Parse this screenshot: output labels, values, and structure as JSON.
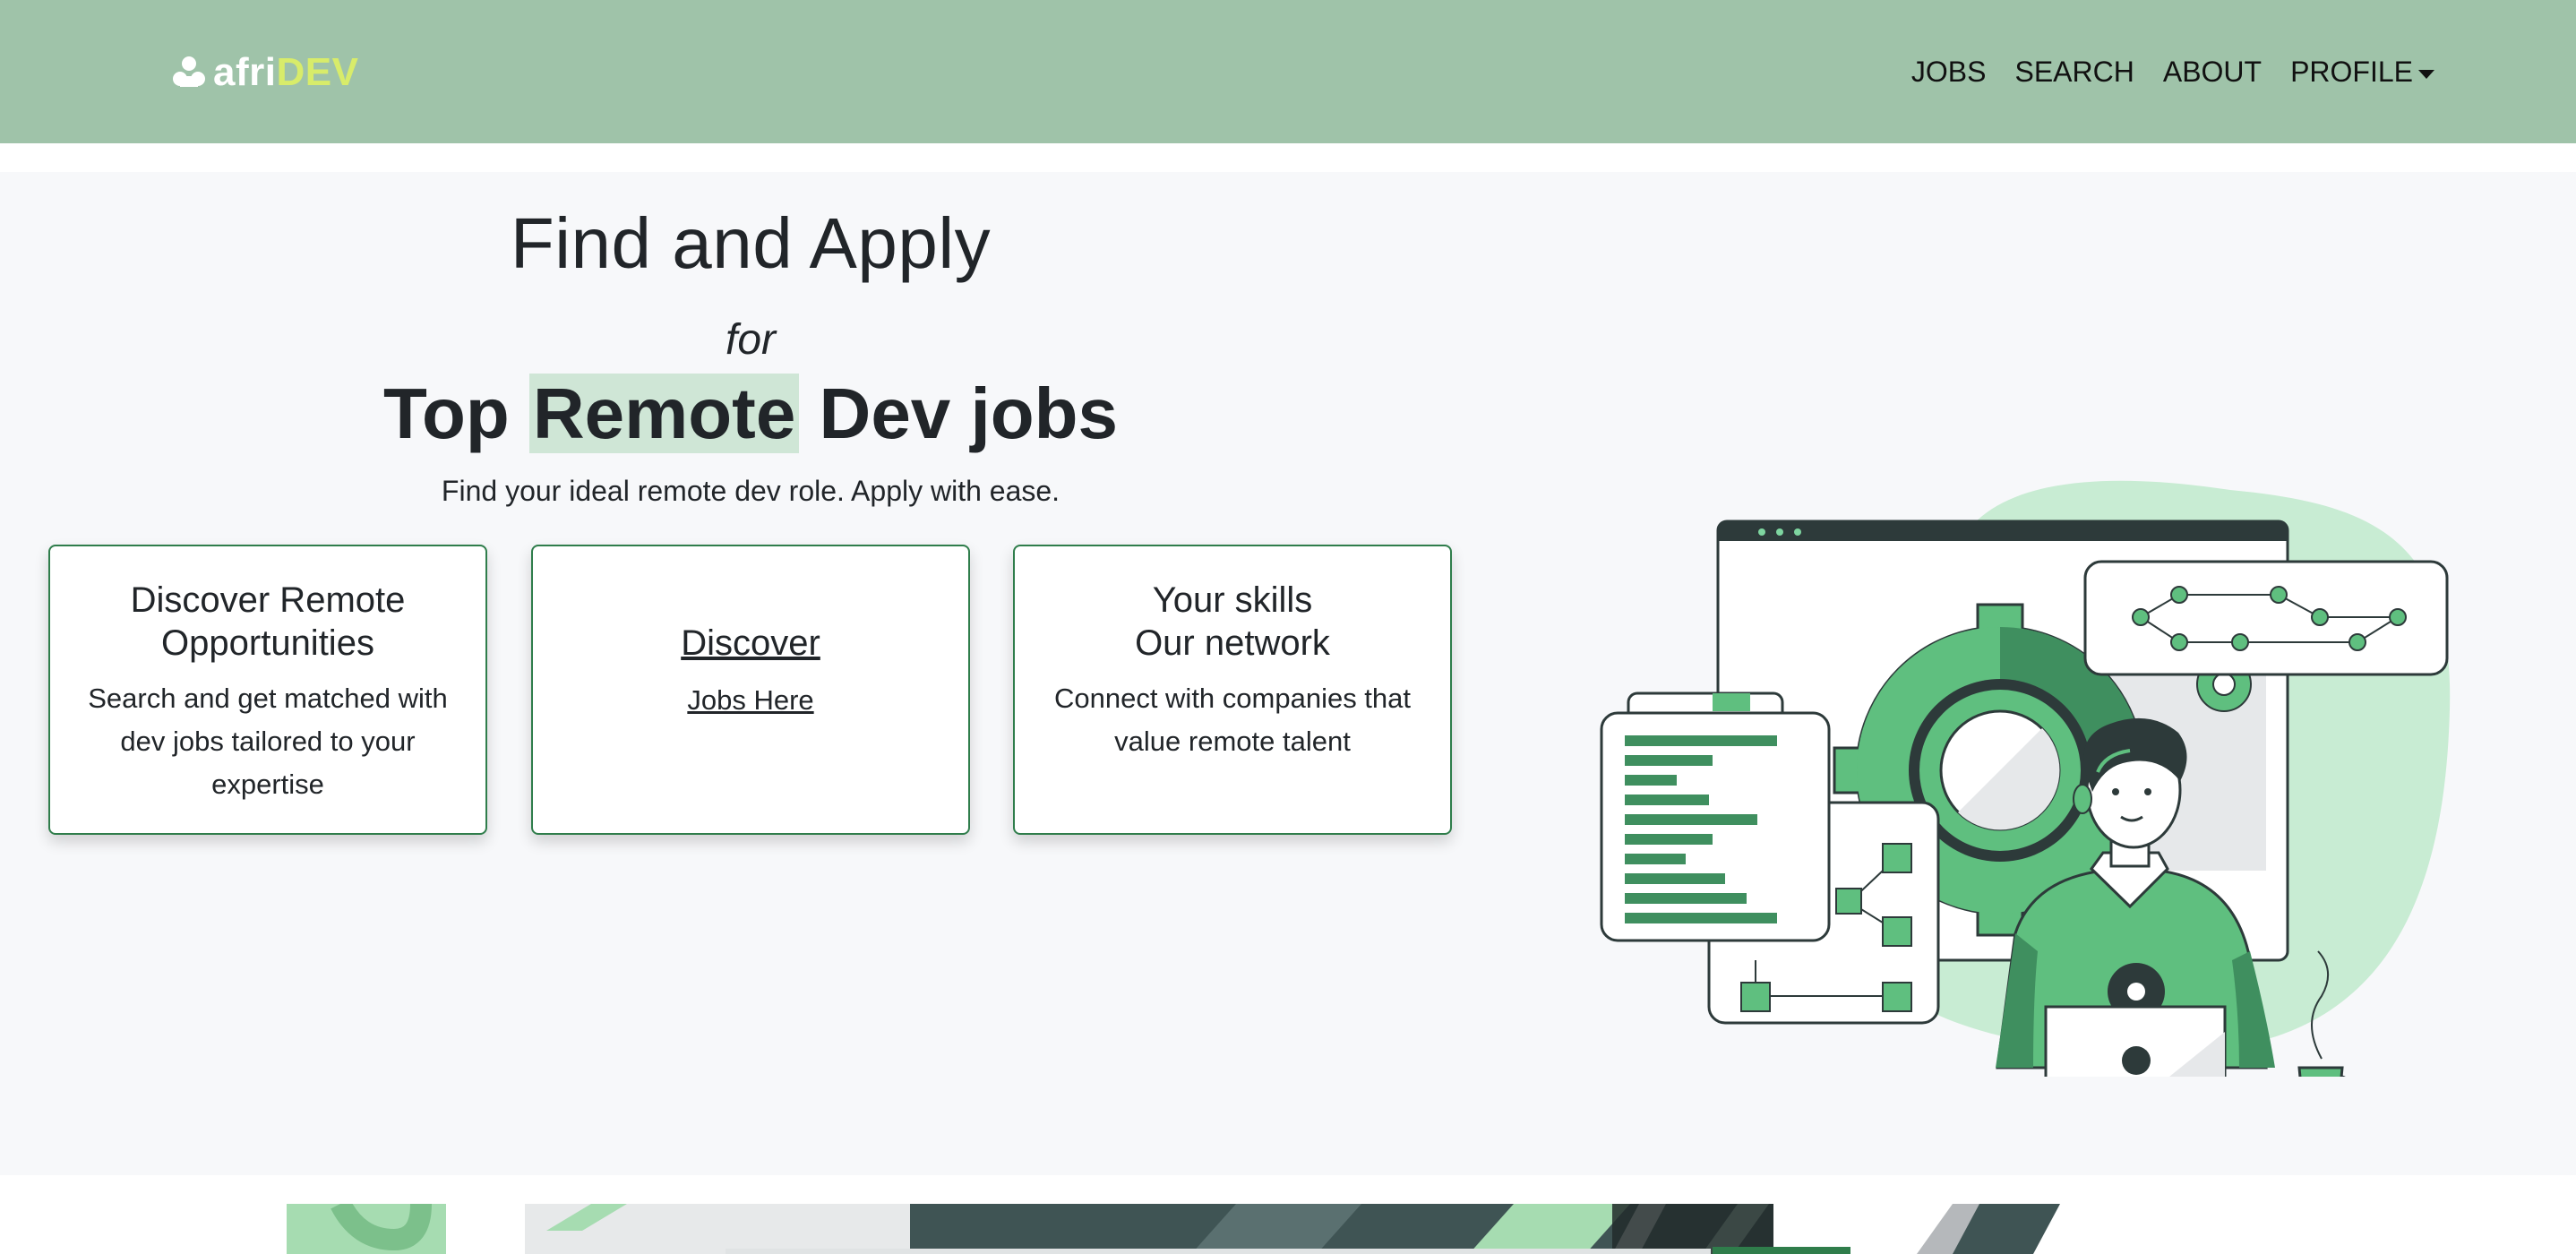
{
  "brand": {
    "name_prefix": "afri",
    "name_accent": "DEV",
    "icon": "people-logo-icon"
  },
  "nav": {
    "items": [
      {
        "label": "JOBS"
      },
      {
        "label": "SEARCH"
      },
      {
        "label": "ABOUT"
      },
      {
        "label": "PROFILE",
        "dropdown": true
      }
    ]
  },
  "hero": {
    "title": "Find and Apply",
    "for_word": "for",
    "subtitle_pre": "Top ",
    "subtitle_highlight": "Remote",
    "subtitle_post": " Dev jobs",
    "tagline": "Find your ideal remote dev role. Apply with ease."
  },
  "cards": [
    {
      "title_line1": "Discover Remote",
      "title_line2": "Opportunities",
      "text": "Search and get matched with dev jobs tailored to your expertise"
    },
    {
      "title": "Discover",
      "link": "Jobs Here"
    },
    {
      "title_line1": "Your skills",
      "title_line2": "Our network",
      "text": "Connect with companies that value remote talent"
    }
  ],
  "colors": {
    "navbar_bg": "#9fc3a9",
    "brand_accent": "#d8ec6a",
    "card_border": "#2f7d4b",
    "highlight": "#cfe6d6",
    "illustration_green": "#5fbf7f",
    "illustration_dark_green": "#3f8f5f",
    "illustration_blob": "#c8ecd3"
  }
}
